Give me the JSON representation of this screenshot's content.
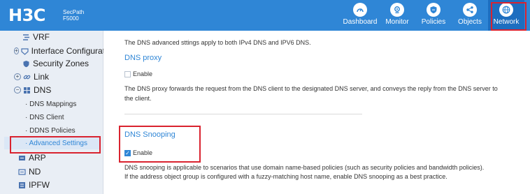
{
  "header": {
    "logo": "H3C",
    "product_line1": "SecPath",
    "product_line2": "F5000",
    "nav": [
      {
        "label": "Dashboard",
        "icon": "dashboard-icon"
      },
      {
        "label": "Monitor",
        "icon": "monitor-icon"
      },
      {
        "label": "Policies",
        "icon": "shield-icon"
      },
      {
        "label": "Objects",
        "icon": "share-nodes-icon"
      },
      {
        "label": "Network",
        "icon": "globe-icon",
        "active": true
      }
    ]
  },
  "sidebar": {
    "items": [
      {
        "label": "VRF"
      },
      {
        "label": "Interface Configuratio"
      },
      {
        "label": "Security Zones"
      },
      {
        "label": "Link"
      },
      {
        "label": "DNS"
      },
      {
        "label": "ARP"
      },
      {
        "label": "ND"
      },
      {
        "label": "IPFW"
      }
    ],
    "dns_children": [
      {
        "label": "· DNS Mappings"
      },
      {
        "label": "· DNS Client"
      },
      {
        "label": "· DDNS Policies"
      },
      {
        "label": "· Advanced Settings",
        "selected": true
      }
    ]
  },
  "main": {
    "intro": "The DNS advanced sttings apply to both IPv4 DNS and IPV6 DNS.",
    "dns_proxy": {
      "title": "DNS proxy",
      "enable_label": "Enable",
      "enabled": false,
      "desc_line1": "The DNS proxy forwards the request from the DNS client to the designated DNS server, and conveys the reply from the DNS server to",
      "desc_line2": "the client."
    },
    "dns_snooping": {
      "title": "DNS Snooping",
      "enable_label": "Enable",
      "enabled": true,
      "desc_line1": "DNS snooping is applicable to scenarios that use domain name-based policies (such as security policies and bandwidth policies).",
      "desc_line2": "If the address object group is configured with a fuzzy-matching host name, enable DNS snooping as a best practice."
    }
  },
  "colors": {
    "header_bg": "#2f86d6",
    "accent": "#2f86d6",
    "highlight_box": "#d9232f",
    "sidebar_bg": "#e9eef5"
  }
}
